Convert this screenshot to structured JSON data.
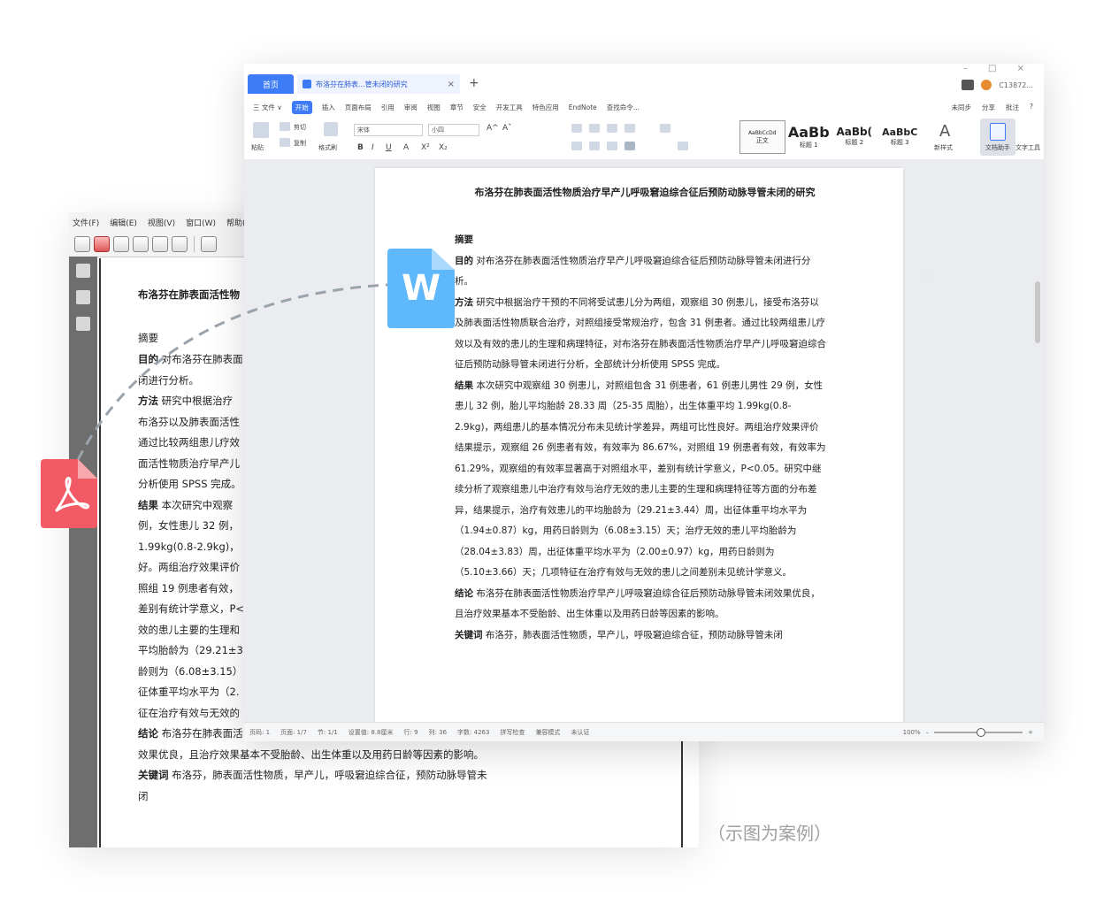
{
  "pdf_window": {
    "menus": [
      "文件(F)",
      "编辑(E)",
      "视图(V)",
      "窗口(W)",
      "帮助(H)"
    ],
    "title": "布洛芬在肺表面活性物",
    "abstract_heading": "摘要",
    "lines": [
      {
        "label": "目的",
        "text": "对布洛芬在肺表面"
      },
      {
        "label": "",
        "text": "闭进行分析。"
      },
      {
        "label": "方法",
        "text": "研究中根据治疗"
      },
      {
        "label": "",
        "text": "布洛芬以及肺表面活性"
      },
      {
        "label": "",
        "text": "通过比较两组患儿疗效"
      },
      {
        "label": "",
        "text": "面活性物质治疗早产儿"
      },
      {
        "label": "",
        "text": "分析使用 SPSS 完成。"
      },
      {
        "label": "结果",
        "text": "本次研究中观察"
      },
      {
        "label": "",
        "text": "例，女性患儿 32 例，"
      },
      {
        "label": "",
        "text": "1.99kg(0.8-2.9kg)，"
      },
      {
        "label": "",
        "text": "好。两组治疗效果评价"
      },
      {
        "label": "",
        "text": "照组 19 例患者有效，"
      },
      {
        "label": "",
        "text": "差别有统计学意义，P<"
      },
      {
        "label": "",
        "text": "效的患儿主要的生理和"
      },
      {
        "label": "",
        "text": "平均胎龄为（29.21±3"
      },
      {
        "label": "",
        "text": "龄则为（6.08±3.15）"
      },
      {
        "label": "",
        "text": "征体重平均水平为（2."
      },
      {
        "label": "",
        "text": "征在治疗有效与无效的"
      },
      {
        "label": "结论",
        "text": "布洛芬在肺表面活"
      },
      {
        "label": "",
        "text": "效果优良，且治疗效果基本不受胎龄、出生体重以及用药日龄等因素的影响。"
      },
      {
        "label": "关键词",
        "text": "布洛芬，肺表面活性物质，早产儿，呼吸窘迫综合征，预防动脉导管未"
      },
      {
        "label": "",
        "text": "闭"
      }
    ]
  },
  "word_window": {
    "home_tab": "首页",
    "doc_tab": "布洛芬在肺表...管未闭的研究",
    "window_controls": "– □ ×",
    "account": "C13872...",
    "menu": [
      "三 文件 ∨",
      "开始",
      "插入",
      "页面布局",
      "引用",
      "审阅",
      "视图",
      "章节",
      "安全",
      "开发工具",
      "特色应用",
      "EndNote",
      "查找命令..."
    ],
    "menu_right": [
      "未同步",
      "分享",
      "批注",
      "?"
    ],
    "active_menu": "开始",
    "font_name": "宋体",
    "font_size": "小四",
    "ribbon_labels": {
      "paste": "粘贴",
      "cut": "剪切",
      "copy": "复制",
      "format_painter": "格式刷",
      "new_style": "新样式",
      "compare": "文档助手",
      "text_tools": "文字工具"
    },
    "styles": [
      {
        "preview": "AaBbCcDd",
        "name": "正文"
      },
      {
        "preview": "AaBb",
        "name": "标题 1"
      },
      {
        "preview": "AaBb(",
        "name": "标题 2"
      },
      {
        "preview": "AaBbC",
        "name": "标题 3"
      }
    ],
    "doc_title": "布洛芬在肺表面活性物质治疗早产儿呼吸窘迫综合征后预防动脉导管未闭的研究",
    "abstract_heading": "摘要",
    "paragraphs": [
      {
        "label": "目的",
        "text": "对布洛芬在肺表面活性物质治疗早产儿呼吸窘迫综合征后预防动脉导管未闭进行分析。"
      },
      {
        "label": "方法",
        "text": "研究中根据治疗干预的不同将受试患儿分为两组，观察组 30 例患儿，接受布洛芬以及肺表面活性物质联合治疗，对照组接受常规治疗，包含 31 例患者。通过比较两组患儿疗效以及有效的患儿的生理和病理特征，对布洛芬在肺表面活性物质治疗早产儿呼吸窘迫综合征后预防动脉导管未闭进行分析，全部统计分析使用 SPSS 完成。"
      },
      {
        "label": "结果",
        "text": "本次研究中观察组 30 例患儿，对照组包含 31 例患者，61 例患儿男性 29 例，女性患儿 32 例，胎儿平均胎龄 28.33 周（25-35 周胎），出生体重平均 1.99kg(0.8-2.9kg)，两组患儿的基本情况分布未见统计学差异，两组可比性良好。两组治疗效果评价结果提示，观察组 26 例患者有效，有效率为 86.67%，对照组 19 例患者有效，有效率为 61.29%，观察组的有效率显著高于对照组水平，差别有统计学意义，P<0.05。研究中继续分析了观察组患儿中治疗有效与治疗无效的患儿主要的生理和病理特征等方面的分布差异，结果提示，治疗有效患儿的平均胎龄为（29.21±3.44）周，出征体重平均水平为（1.94±0.87）kg，用药日龄则为（6.08±3.15）天；治疗无效的患儿平均胎龄为（28.04±3.83）周，出征体重平均水平为（2.00±0.97）kg，用药日龄则为（5.10±3.66）天；几项特征在治疗有效与无效的患儿之间差别未见统计学意义。"
      },
      {
        "label": "结论",
        "text": "布洛芬在肺表面活性物质治疗早产儿呼吸窘迫综合征后预防动脉导管未闭效果优良，且治疗效果基本不受胎龄、出生体重以及用药日龄等因素的影响。"
      },
      {
        "label": "关键词",
        "text": "布洛芬，肺表面活性物质，早产儿，呼吸窘迫综合征，预防动脉导管未闭"
      }
    ],
    "status": [
      "页码: 1",
      "页面: 1/7",
      "节: 1/1",
      "设置值: 8.8厘米",
      "行: 9",
      "列: 36",
      "字数: 4263",
      "拼写检查",
      "兼容模式",
      "未认证"
    ],
    "zoom": "100%"
  },
  "badges": {
    "word_letter": "W"
  },
  "caption": "（示图为案例）",
  "colors": {
    "word_blue": "#5fb8fb",
    "pdf_red": "#f25b66",
    "accent": "#3d7bf7"
  }
}
